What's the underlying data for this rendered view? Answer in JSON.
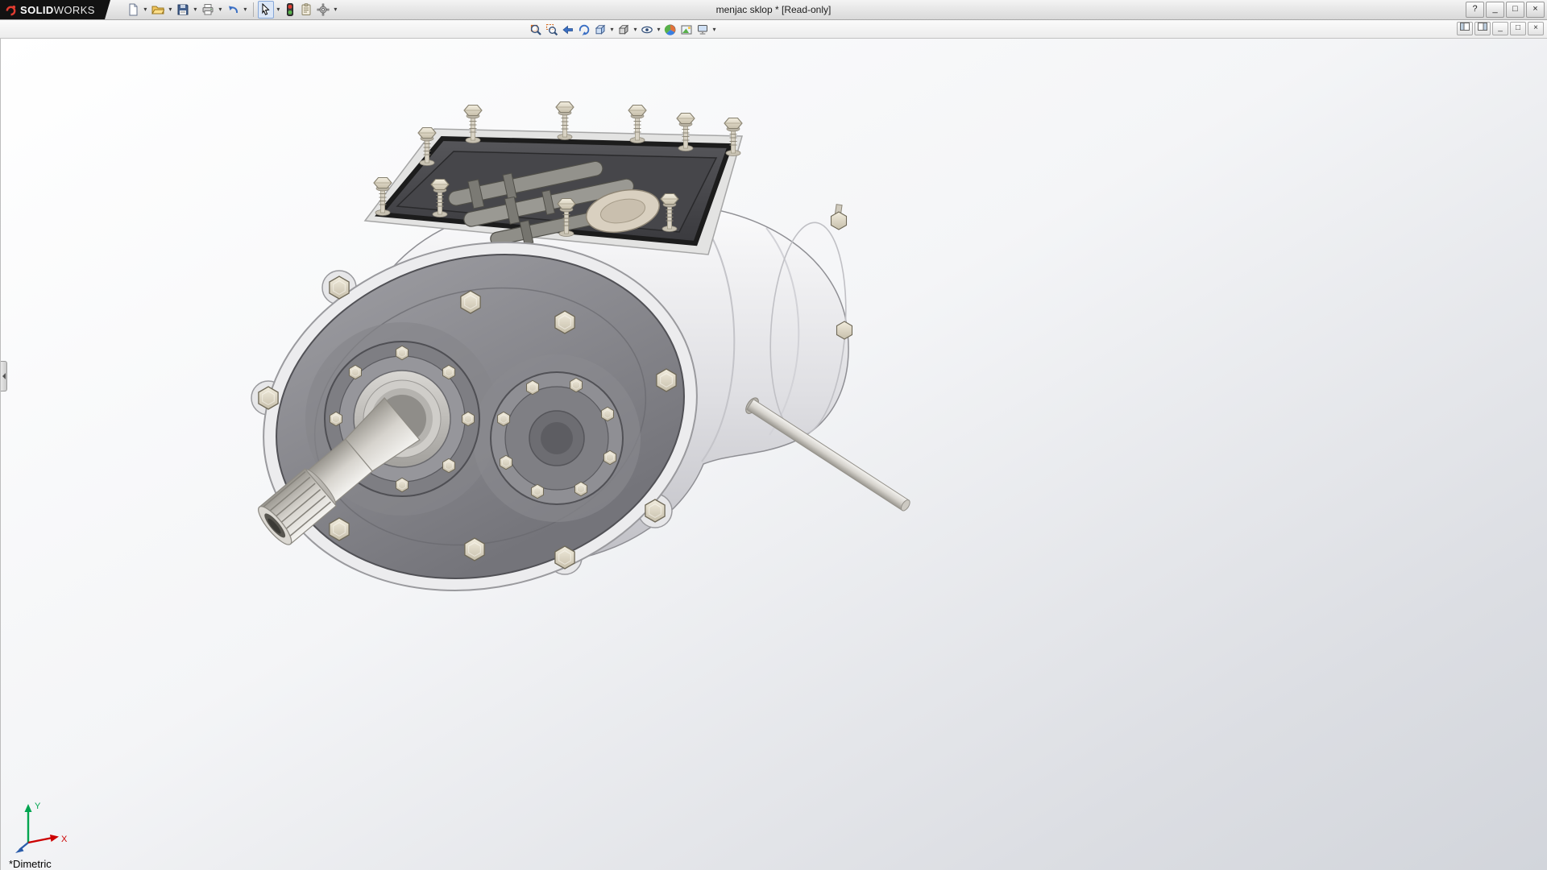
{
  "window": {
    "brand": "SOLIDWORKS",
    "brand_bold": "SOLID",
    "brand_light": "WORKS",
    "title": "menjac sklop * [Read-only]",
    "controls": {
      "help": "?",
      "minimize": "_",
      "maximize": "□",
      "close": "×"
    }
  },
  "glyphs": {
    "dropdown": "▾",
    "minimize": "_",
    "restore": "□",
    "close": "×"
  },
  "main_toolbar": {
    "items": [
      {
        "name": "new",
        "dropdown": true
      },
      {
        "name": "open",
        "dropdown": true
      },
      {
        "name": "save",
        "dropdown": true
      },
      {
        "name": "print",
        "dropdown": true
      },
      {
        "name": "undo",
        "dropdown": true
      },
      {
        "name": "select",
        "dropdown": true,
        "pressed": true
      },
      {
        "name": "status-light",
        "dropdown": false
      },
      {
        "name": "feature-properties",
        "dropdown": false
      },
      {
        "name": "options",
        "dropdown": true
      }
    ]
  },
  "view_toolbar": {
    "items": [
      {
        "name": "zoom-to-fit",
        "dropdown": false
      },
      {
        "name": "zoom-to-area",
        "dropdown": false
      },
      {
        "name": "previous-view",
        "dropdown": false
      },
      {
        "name": "rotate-view",
        "dropdown": false
      },
      {
        "name": "view-orientation",
        "dropdown": true
      },
      {
        "name": "display-style",
        "dropdown": true
      },
      {
        "name": "hide-show-items",
        "dropdown": true
      },
      {
        "name": "edit-appearance",
        "dropdown": false
      },
      {
        "name": "apply-scene",
        "dropdown": false
      },
      {
        "name": "view-settings",
        "dropdown": true
      }
    ]
  },
  "document_controls": {
    "items": [
      "pane-left",
      "pane-right",
      "minimize-document",
      "restore-document",
      "close-document"
    ]
  },
  "viewport": {
    "view_name": "*Dimetric",
    "triad": {
      "x_label": "X",
      "y_label": "Y"
    }
  },
  "colors": {
    "selection_accent": "#86a7d8",
    "viewport_top": "#ffffff",
    "viewport_bottom": "#d2d5db",
    "axis_x": "#cc0000",
    "axis_y": "#00a550",
    "axis_z": "#2a5caa"
  }
}
